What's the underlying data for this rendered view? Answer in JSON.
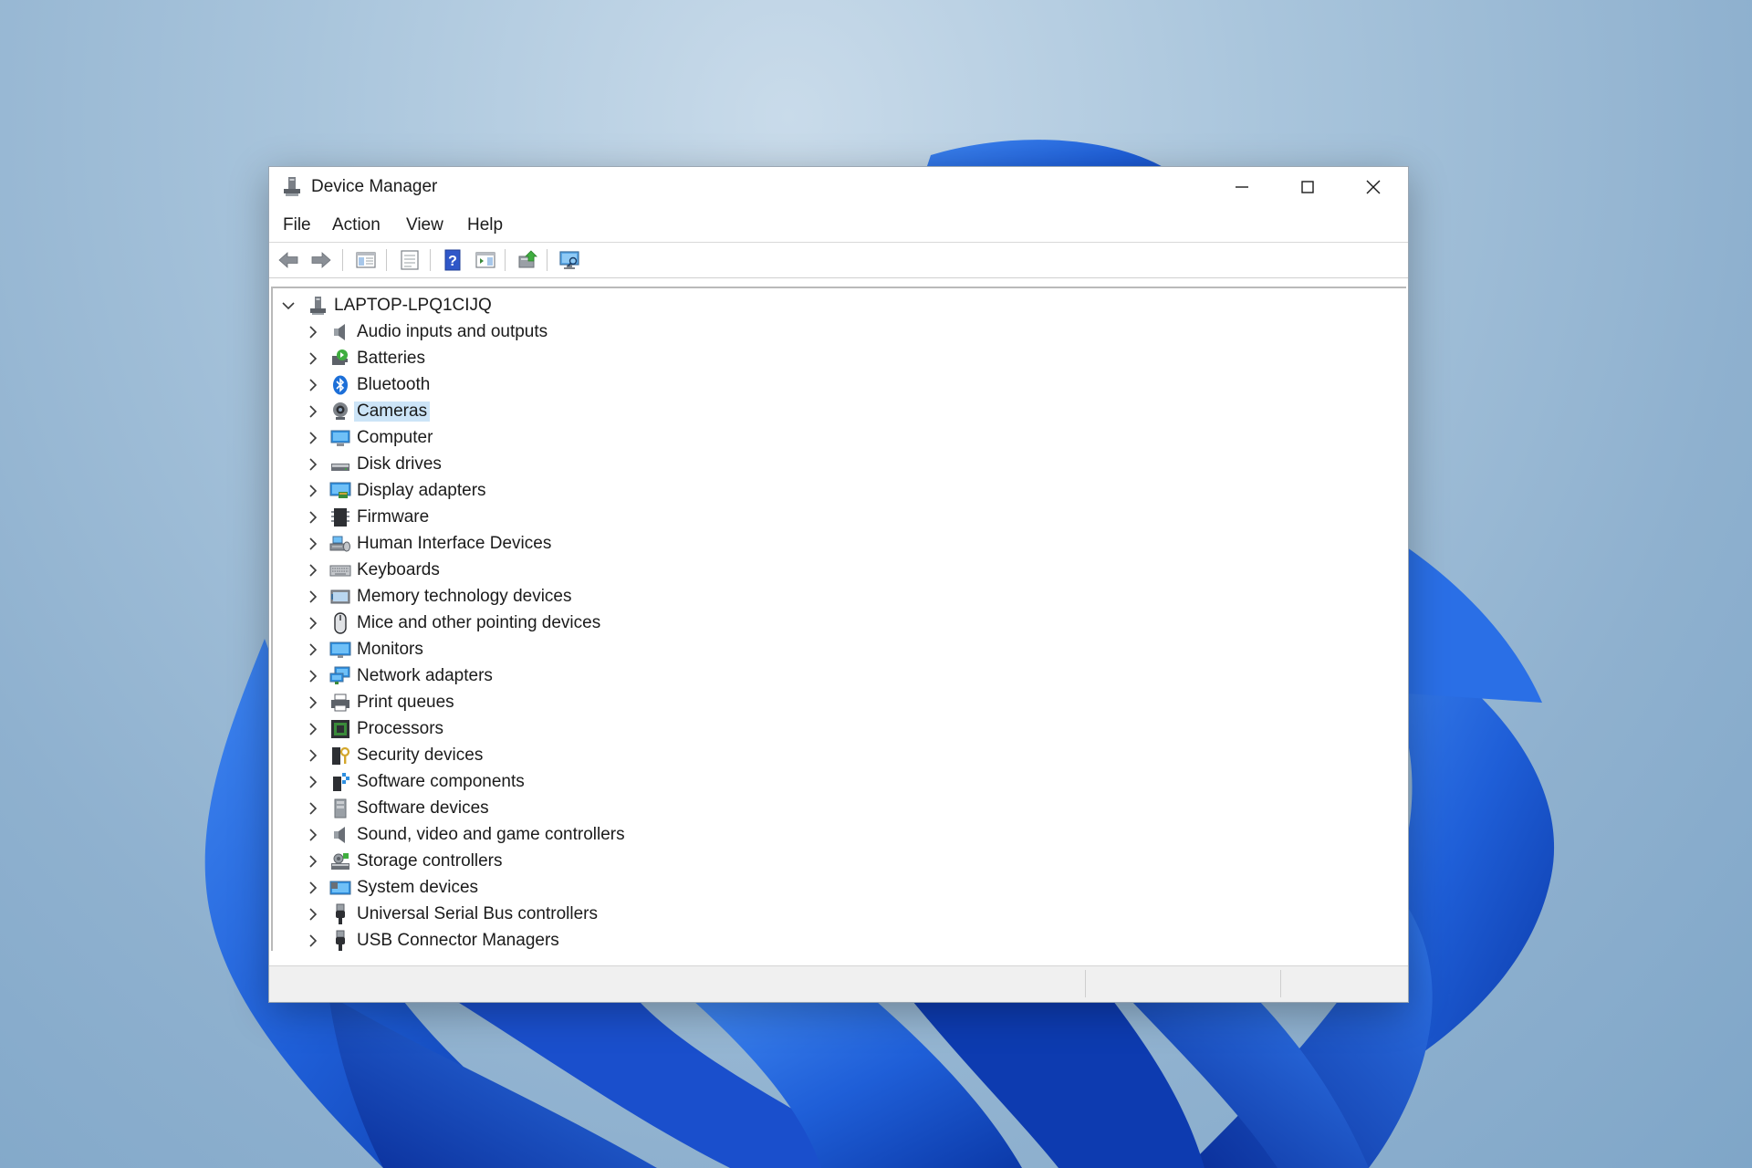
{
  "window": {
    "title": "Device Manager",
    "controls": {
      "minimize": "minimize",
      "maximize": "maximize",
      "close": "close"
    }
  },
  "menu": {
    "items": [
      "File",
      "Action",
      "View",
      "Help"
    ]
  },
  "toolbar": {
    "buttons": [
      {
        "icon": "back-arrow-icon"
      },
      {
        "icon": "forward-arrow-icon"
      },
      {
        "icon": "show-hide-console-tree-icon"
      },
      {
        "icon": "properties-icon"
      },
      {
        "icon": "help-icon"
      },
      {
        "icon": "action-pane-icon"
      },
      {
        "icon": "update-driver-icon"
      },
      {
        "icon": "scan-hardware-icon"
      }
    ]
  },
  "tree": {
    "root": {
      "label": "LAPTOP-LPQ1CIJQ",
      "expanded": true
    },
    "selected": "Cameras",
    "categories": [
      {
        "label": "Audio inputs and outputs",
        "icon": "speaker-icon"
      },
      {
        "label": "Batteries",
        "icon": "battery-icon"
      },
      {
        "label": "Bluetooth",
        "icon": "bluetooth-icon"
      },
      {
        "label": "Cameras",
        "icon": "camera-icon"
      },
      {
        "label": "Computer",
        "icon": "computer-icon"
      },
      {
        "label": "Disk drives",
        "icon": "disk-drive-icon"
      },
      {
        "label": "Display adapters",
        "icon": "display-adapter-icon"
      },
      {
        "label": "Firmware",
        "icon": "firmware-icon"
      },
      {
        "label": "Human Interface Devices",
        "icon": "hid-icon"
      },
      {
        "label": "Keyboards",
        "icon": "keyboard-icon"
      },
      {
        "label": "Memory technology devices",
        "icon": "memory-icon"
      },
      {
        "label": "Mice and other pointing devices",
        "icon": "mouse-icon"
      },
      {
        "label": "Monitors",
        "icon": "monitor-icon"
      },
      {
        "label": "Network adapters",
        "icon": "network-adapter-icon"
      },
      {
        "label": "Print queues",
        "icon": "printer-icon"
      },
      {
        "label": "Processors",
        "icon": "processor-icon"
      },
      {
        "label": "Security devices",
        "icon": "security-device-icon"
      },
      {
        "label": "Software components",
        "icon": "software-component-icon"
      },
      {
        "label": "Software devices",
        "icon": "software-device-icon"
      },
      {
        "label": "Sound, video and game controllers",
        "icon": "sound-controller-icon"
      },
      {
        "label": "Storage controllers",
        "icon": "storage-controller-icon"
      },
      {
        "label": "System devices",
        "icon": "system-devices-icon"
      },
      {
        "label": "Universal Serial Bus controllers",
        "icon": "usb-icon"
      },
      {
        "label": "USB Connector Managers",
        "icon": "usb-connector-icon"
      }
    ]
  },
  "colors": {
    "accent": "#0067c0",
    "selection": "#cce4f7",
    "wallpaper_bloom": "#1f5fd8"
  }
}
